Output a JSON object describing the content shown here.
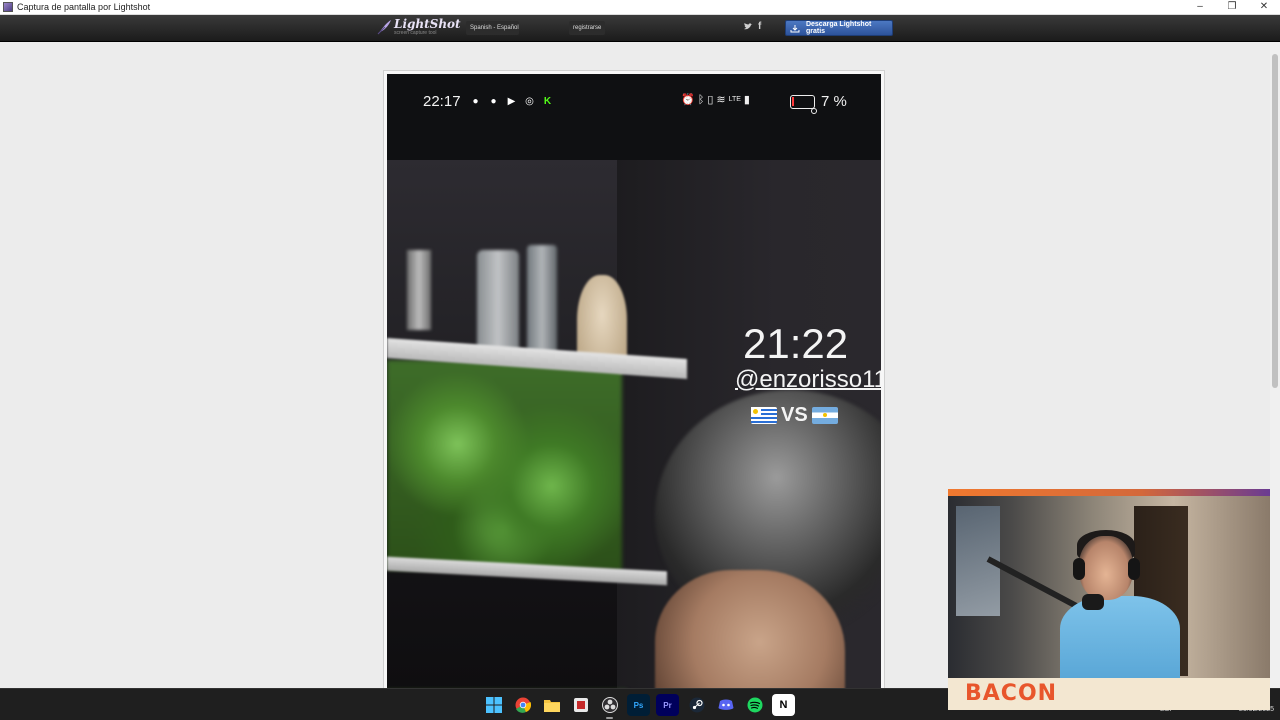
{
  "window": {
    "title": "Captura de pantalla por Lightshot",
    "controls": [
      "–",
      "❐",
      "✕"
    ]
  },
  "lightshot": {
    "logo_name": "LightShot",
    "logo_tagline": "screen capture tool",
    "language": "Spanish - Español",
    "register": "registrarse",
    "social": {
      "facebook": "f"
    },
    "download_label": "Descarga Lightshot gratis"
  },
  "phone": {
    "status_time": "22:17",
    "battery_pct": "7 %",
    "network": "LTE"
  },
  "story": {
    "time": "21:22",
    "handle": "@enzorisso11",
    "vs": "VS"
  },
  "taskbar": {
    "apps": [
      {
        "name": "start",
        "label": ""
      },
      {
        "name": "chrome",
        "label": ""
      },
      {
        "name": "file-explorer",
        "label": ""
      },
      {
        "name": "snipping",
        "label": ""
      },
      {
        "name": "obs",
        "label": ""
      },
      {
        "name": "photoshop",
        "label": "Ps"
      },
      {
        "name": "premiere",
        "label": "Pr"
      },
      {
        "name": "steam",
        "label": ""
      },
      {
        "name": "discord",
        "label": ""
      },
      {
        "name": "spotify",
        "label": ""
      },
      {
        "name": "notion",
        "label": "N"
      }
    ],
    "lang": "ESP",
    "date": "20/02/2025"
  },
  "webcam": {
    "label": "BACON"
  },
  "colors": {
    "accent": "#e8562c",
    "download": "#3a64ad",
    "taskbar": "#1f1f1f"
  }
}
